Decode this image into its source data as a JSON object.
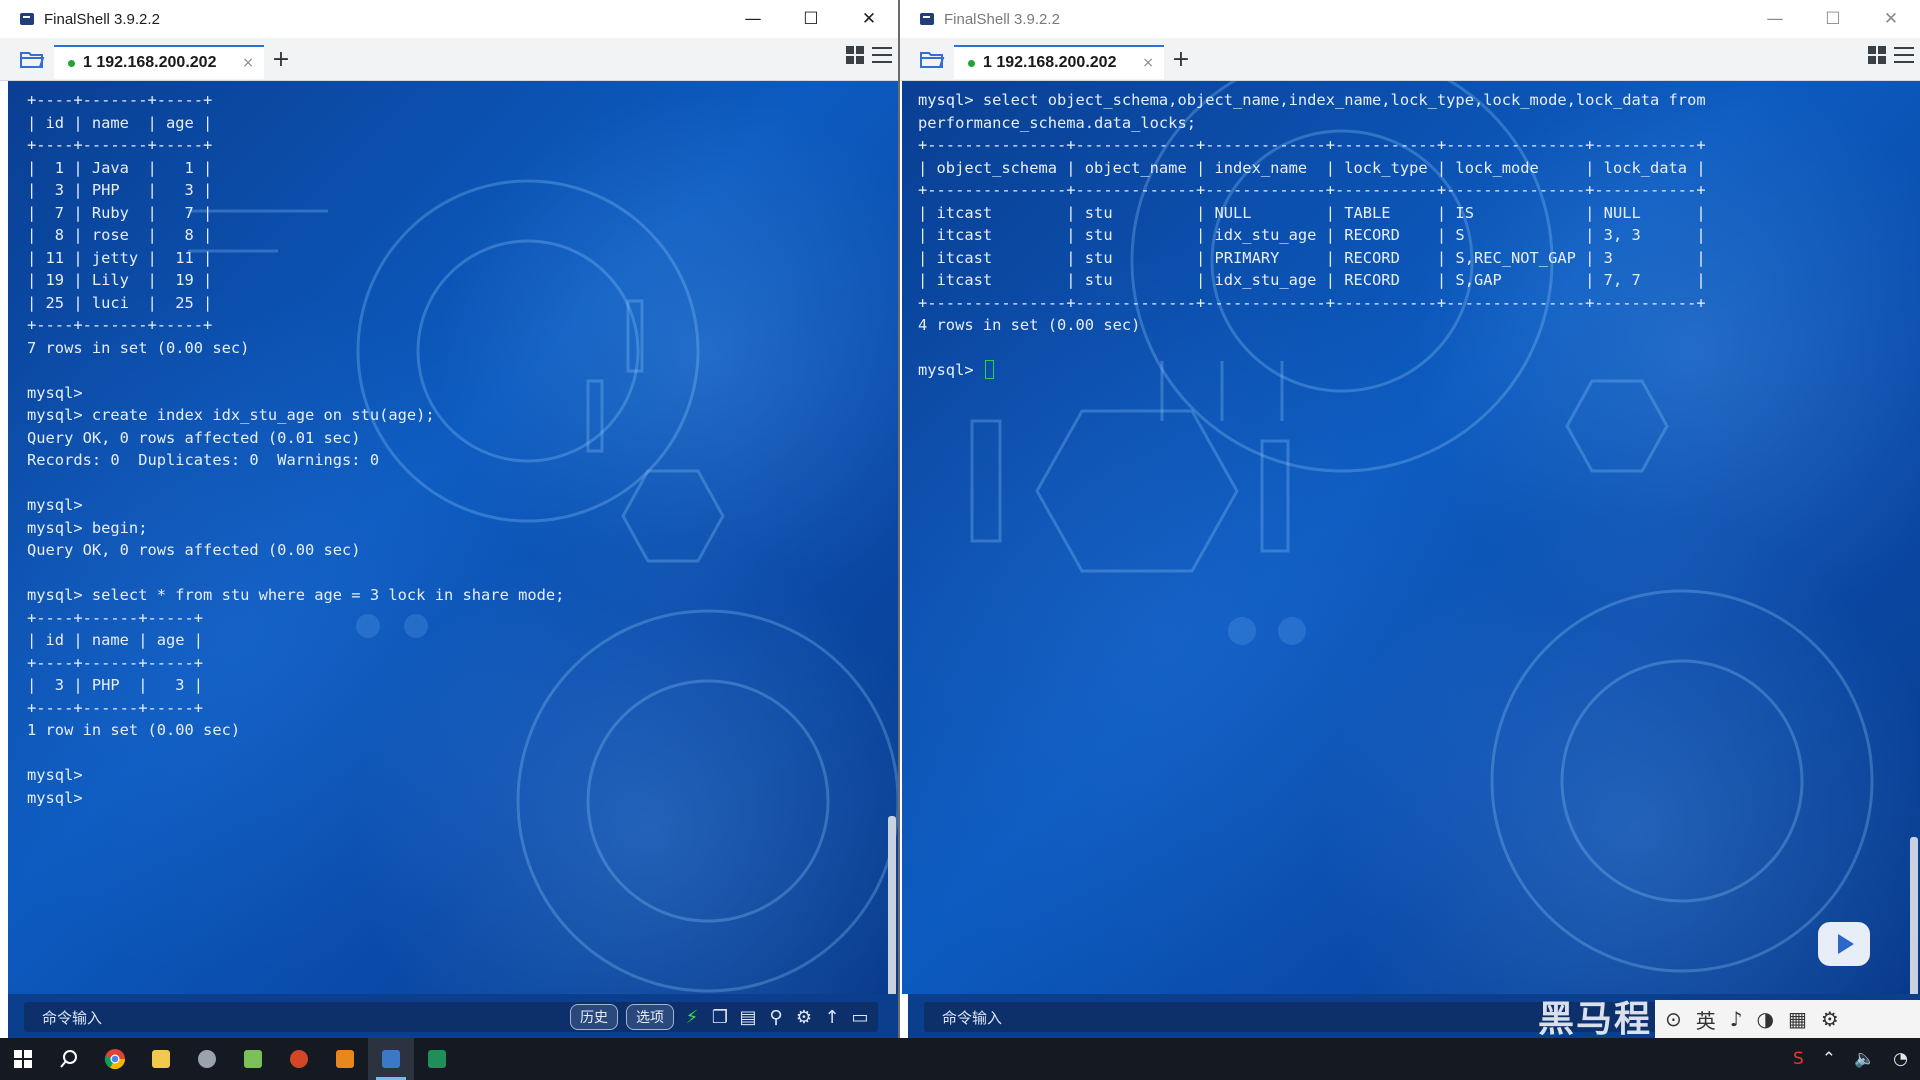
{
  "left_window": {
    "title": "FinalShell 3.9.2.2",
    "controls": {
      "minimize": "—",
      "maximize": "☐",
      "close": "✕"
    },
    "tab": {
      "label": "1 192.168.200.202",
      "close": "×",
      "add": "+"
    },
    "terminal_lines": [
      "+----+-------+-----+",
      "| id | name  | age |",
      "+----+-------+-----+",
      "|  1 | Java  |   1 |",
      "|  3 | PHP   |   3 |",
      "|  7 | Ruby  |   7 |",
      "|  8 | rose  |   8 |",
      "| 11 | jetty |  11 |",
      "| 19 | Lily  |  19 |",
      "| 25 | luci  |  25 |",
      "+----+-------+-----+",
      "7 rows in set (0.00 sec)",
      "",
      "mysql>",
      "mysql> create index idx_stu_age on stu(age);",
      "Query OK, 0 rows affected (0.01 sec)",
      "Records: 0  Duplicates: 0  Warnings: 0",
      "",
      "mysql>",
      "mysql> begin;",
      "Query OK, 0 rows affected (0.00 sec)",
      "",
      "mysql> select * from stu where age = 3 lock in share mode;",
      "+----+------+-----+",
      "| id | name | age |",
      "+----+------+-----+",
      "|  3 | PHP  |   3 |",
      "+----+------+-----+",
      "1 row in set (0.00 sec)",
      "",
      "mysql>",
      "mysql>"
    ],
    "cmd_input_label": "命令输入",
    "history_button": "历史",
    "options_button": "选项"
  },
  "right_window": {
    "title": "FinalShell 3.9.2.2",
    "controls": {
      "minimize": "—",
      "maximize": "☐",
      "close": "✕"
    },
    "tab": {
      "label": "1 192.168.200.202",
      "close": "×",
      "add": "+"
    },
    "terminal_lines": [
      "mysql> select object_schema,object_name,index_name,lock_type,lock_mode,lock_data from",
      "performance_schema.data_locks;",
      "+---------------+-------------+-------------+-----------+---------------+-----------+",
      "| object_schema | object_name | index_name  | lock_type | lock_mode     | lock_data |",
      "+---------------+-------------+-------------+-----------+---------------+-----------+",
      "| itcast        | stu         | NULL        | TABLE     | IS            | NULL      |",
      "| itcast        | stu         | idx_stu_age | RECORD    | S             | 3, 3      |",
      "| itcast        | stu         | PRIMARY     | RECORD    | S,REC_NOT_GAP | 3         |",
      "| itcast        | stu         | idx_stu_age | RECORD    | S,GAP         | 7, 7      |",
      "+---------------+-------------+-------------+-----------+---------------+-----------+",
      "4 rows in set (0.00 sec)",
      "",
      "mysql> "
    ],
    "cmd_input_label": "命令输入"
  },
  "watermark": "黑马程",
  "ime": {
    "lang": "英"
  },
  "colors": {
    "terminal_bg": "#0c5bc0",
    "tab_accent": "#2f6fd6",
    "cursor": "#27d24e",
    "taskbar": "#151a22"
  }
}
